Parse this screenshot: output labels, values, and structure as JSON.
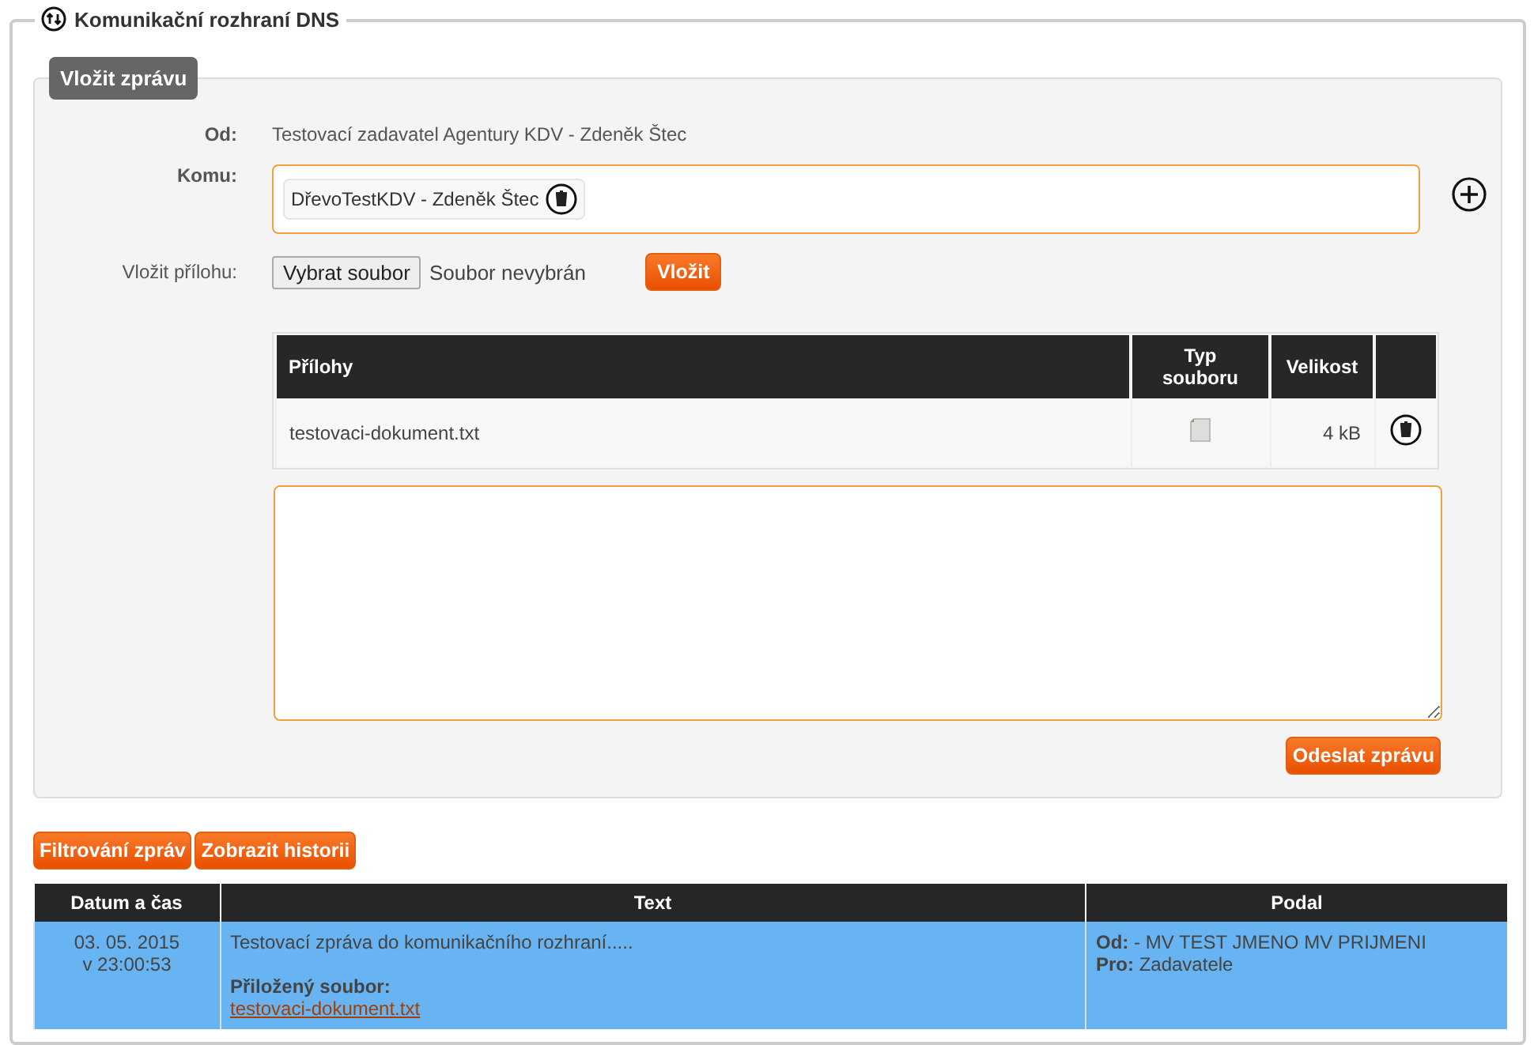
{
  "section": {
    "title": "Komunikační rozhraní DNS"
  },
  "compose": {
    "tab": "Vložit zprávu",
    "from": {
      "label": "Od:",
      "value": "Testovací zadavatel Agentury KDV - Zdeněk Štec"
    },
    "to": {
      "label": "Komu:",
      "recipients": [
        "DřevoTestKDV - Zdeněk Štec"
      ]
    },
    "attach": {
      "label": "Vložit přílohu:",
      "choose_button": "Vybrat soubor",
      "file_status": "Soubor nevybrán",
      "insert_button": "Vložit"
    },
    "attachments": {
      "columns": [
        "Přílohy",
        "Typ souboru",
        "Velikost"
      ],
      "rows": [
        {
          "name": "testovaci-dokument.txt",
          "size": "4 kB"
        }
      ]
    },
    "send_button": "Odeslat zprávu"
  },
  "actions": [
    "Filtrování zpráv",
    "Zobrazit historii"
  ],
  "messages": {
    "columns": [
      "Datum a čas",
      "Text",
      "Podal"
    ],
    "rows": [
      {
        "selected": true,
        "date": "03. 05. 2015",
        "time": "v 23:00:53",
        "text": "Testovací zpráva do komunikačního rozhraní.....",
        "attached_label": "Přiložený soubor:",
        "attached_file": "testovaci-dokument.txt",
        "from": "**Od:** - MV TEST JMENO MV PRIJMENI",
        "to": "**Pro:** Zadavatele"
      }
    ]
  }
}
